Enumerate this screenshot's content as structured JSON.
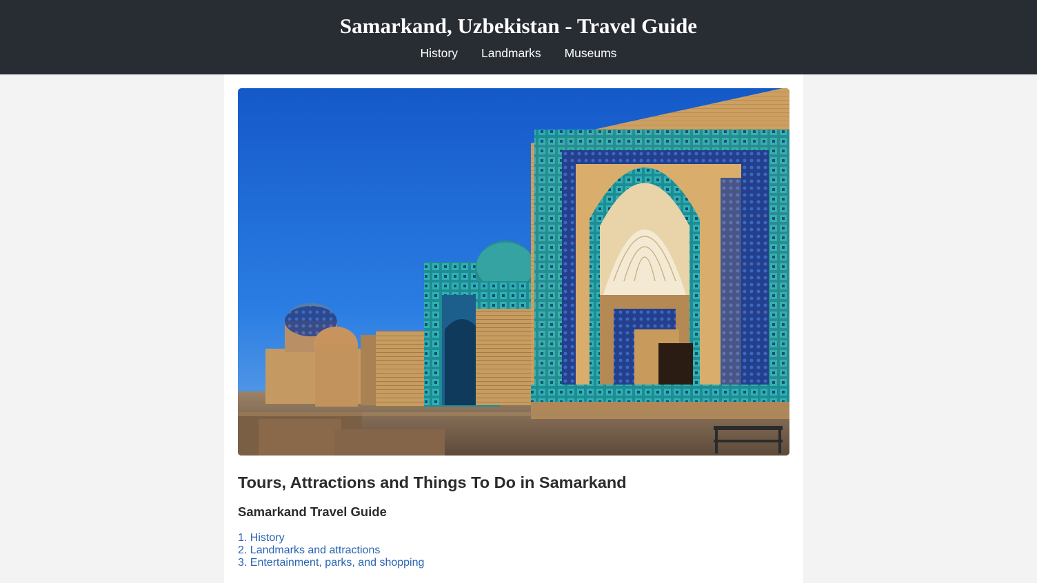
{
  "header": {
    "title": "Samarkand, Uzbekistan - Travel Guide",
    "nav": [
      "History",
      "Landmarks",
      "Museums"
    ]
  },
  "hero": {
    "image_description_icon": "samarkand-shah-i-zinda-photo"
  },
  "main": {
    "title": "Tours, Attractions and Things To Do in Samarkand",
    "subtitle": "Samarkand Travel Guide",
    "toc": [
      "1. History",
      "2. Landmarks and attractions",
      "3. Entertainment, parks, and shopping"
    ]
  },
  "colors": {
    "header_bg": "#282c33",
    "page_bg": "#f3f3f3",
    "link": "#2863b3"
  }
}
